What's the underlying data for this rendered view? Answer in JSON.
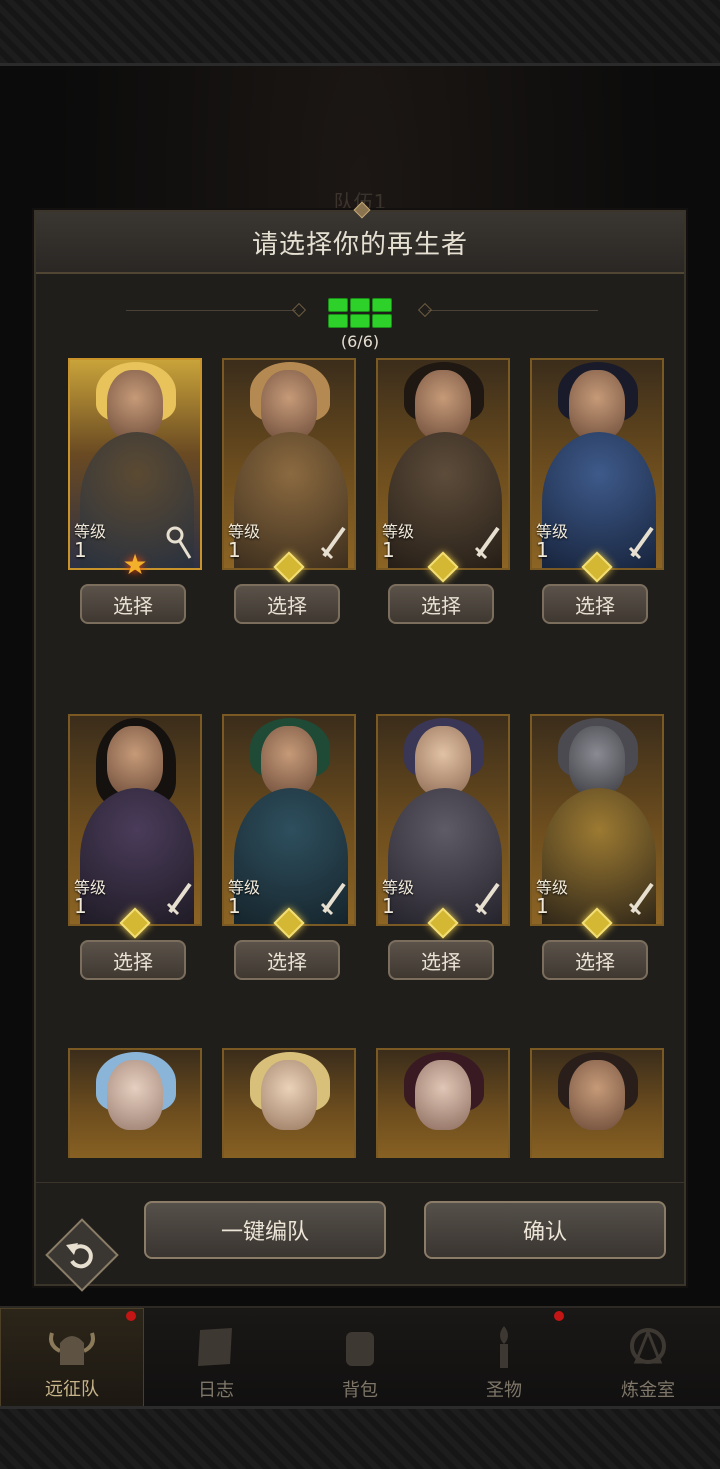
{
  "background": {
    "team_title": "队伍1"
  },
  "modal": {
    "title": "请选择你的再生者",
    "team_count": "(6/6)",
    "filled_slots": 6,
    "heroes": [
      {
        "level_label": "等级",
        "level": "1",
        "weapon_icon": "staff-icon",
        "rank": "star",
        "select_label": "选择"
      },
      {
        "level_label": "等级",
        "level": "1",
        "weapon_icon": "sword-icon",
        "rank": "gem",
        "select_label": "选择"
      },
      {
        "level_label": "等级",
        "level": "1",
        "weapon_icon": "sword-icon",
        "rank": "gem",
        "select_label": "选择"
      },
      {
        "level_label": "等级",
        "level": "1",
        "weapon_icon": "sword-icon",
        "rank": "gem",
        "select_label": "选择"
      },
      {
        "level_label": "等级",
        "level": "1",
        "weapon_icon": "sword-icon",
        "rank": "gem",
        "select_label": "选择"
      },
      {
        "level_label": "等级",
        "level": "1",
        "weapon_icon": "sword-icon",
        "rank": "gem",
        "select_label": "选择"
      },
      {
        "level_label": "等级",
        "level": "1",
        "weapon_icon": "sword-icon",
        "rank": "gem",
        "select_label": "选择"
      },
      {
        "level_label": "等级",
        "level": "1",
        "weapon_icon": "sword-icon",
        "rank": "gem",
        "select_label": "选择"
      }
    ],
    "auto_team_label": "一键编队",
    "confirm_label": "确认"
  },
  "nav": {
    "items": [
      {
        "label": "远征队",
        "icon": "helmet-icon",
        "active": true
      },
      {
        "label": "日志",
        "icon": "scroll-icon",
        "active": false
      },
      {
        "label": "背包",
        "icon": "bag-icon",
        "active": false
      },
      {
        "label": "圣物",
        "icon": "torch-icon",
        "active": false
      },
      {
        "label": "炼金室",
        "icon": "alchemy-icon",
        "active": false
      }
    ]
  },
  "colors": {
    "slot_green": "#2ed12a",
    "accent_gold": "#c8932a",
    "notify_red": "#c41515"
  }
}
